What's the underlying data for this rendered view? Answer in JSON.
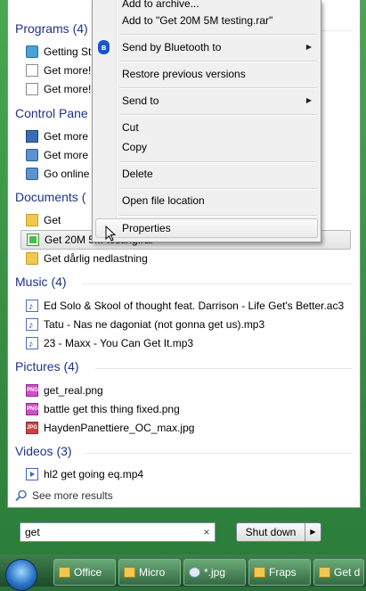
{
  "start_menu": {
    "sections": {
      "programs": {
        "header": "Programs (4)",
        "items": [
          {
            "label": "Getting St",
            "icon": "network-icon"
          },
          {
            "label": "Get more!",
            "icon": "document-icon"
          },
          {
            "label": "Get more!",
            "icon": "document-icon"
          }
        ]
      },
      "control_panel": {
        "header": "Control Pane",
        "items": [
          {
            "label": "Get more",
            "icon": "monitor-icon"
          },
          {
            "label": "Get more",
            "icon": "app-icon"
          },
          {
            "label": "Go online",
            "icon": "app-icon"
          }
        ]
      },
      "documents": {
        "header": "Documents (",
        "items": [
          {
            "label": "Get",
            "icon": "folder-icon"
          },
          {
            "label": "Get 20M 5M testing.rar",
            "icon": "rar-archive-icon",
            "selected": true
          },
          {
            "label": "Get dårlig nedlastning",
            "icon": "folder-icon"
          }
        ]
      },
      "music": {
        "header": "Music (4)",
        "items": [
          {
            "label": "Ed Solo & Skool of thought feat. Darrison - Life Get's Better.ac3",
            "icon": "music-file-icon"
          },
          {
            "label": "Tatu - Nas ne dagoniat (not gonna get us).mp3",
            "icon": "music-file-icon"
          },
          {
            "label": "23 - Maxx - You Can Get It.mp3",
            "icon": "music-file-icon"
          }
        ]
      },
      "pictures": {
        "header": "Pictures (4)",
        "items": [
          {
            "label": "get_real.png",
            "icon": "png-file-icon",
            "badge": "PNG"
          },
          {
            "label": "battle get this thing fixed.png",
            "icon": "png-file-icon",
            "badge": "PNG"
          },
          {
            "label": "HaydenPanettiere_OC_max.jpg",
            "icon": "jpg-file-icon",
            "badge": "JPG"
          }
        ]
      },
      "videos": {
        "header": "Videos (3)",
        "items": [
          {
            "label": "hl2 get going eq.mp4",
            "icon": "video-file-icon"
          }
        ]
      }
    },
    "see_more": "See more results",
    "search": {
      "value": "get",
      "clear": "×"
    },
    "shutdown": {
      "label": "Shut down",
      "arrow": "▶"
    }
  },
  "context_menu": {
    "items": [
      {
        "label": "Add to archive..."
      },
      {
        "label": "Add to \"Get 20M 5M testing.rar\""
      },
      {
        "label": "Send by Bluetooth to",
        "submenu": true,
        "icon": "bluetooth-icon"
      },
      {
        "label": "Restore previous versions"
      },
      {
        "label": "Send to",
        "submenu": true
      },
      {
        "label": "Cut"
      },
      {
        "label": "Copy"
      },
      {
        "label": "Delete"
      },
      {
        "label": "Open file location"
      },
      {
        "label": "Properties",
        "highlighted": true
      }
    ],
    "submenu_arrow": "▶",
    "bluetooth_glyph": "ʙ"
  },
  "taskbar": {
    "buttons": [
      {
        "label": "Office",
        "icon": "folder-icon"
      },
      {
        "label": "Micro",
        "icon": "folder-icon"
      },
      {
        "label": "*.jpg",
        "icon": "search-icon"
      },
      {
        "label": "Fraps",
        "icon": "folder-icon"
      },
      {
        "label": "Get d",
        "icon": "folder-icon"
      }
    ]
  },
  "colors": {
    "section_header": "#1e3287",
    "taskbar": "#2b6b3c",
    "frame": "#49a84f"
  }
}
